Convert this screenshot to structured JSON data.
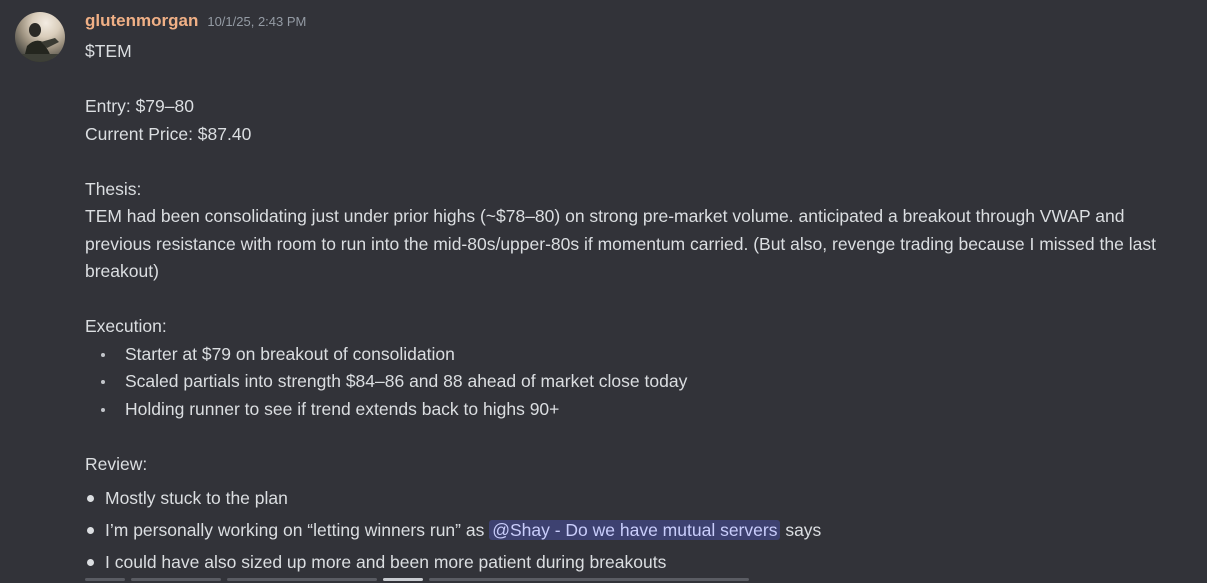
{
  "message": {
    "username": "glutenmorgan",
    "timestamp": "10/1/25, 2:43 PM",
    "avatar_icon": "user-avatar-photo",
    "username_color": "#f0b086",
    "ticker": "$TEM",
    "entry": "Entry: $79–80",
    "current_price": "Current Price: $87.40",
    "thesis_heading": "Thesis:",
    "thesis_text": "TEM had been consolidating just under prior highs (~$78–80) on strong pre-market volume. anticipated a breakout through VWAP and previous resistance with room to run into the mid-80s/upper-80s if momentum carried. (But also, revenge trading because I missed the last breakout)",
    "execution_heading": "Execution:",
    "execution_items": [
      "Starter at $79 on breakout of consolidation",
      "Scaled partials into strength $84–86 and 88 ahead of market close today",
      "Holding runner to see if trend extends back to highs 90+"
    ],
    "review_heading": "Review:",
    "review_items": [
      {
        "text": "Mostly stuck to the plan"
      },
      {
        "before": "I’m personally working on “letting winners run” as ",
        "mention": "@Shay - Do we have mutual servers",
        "after": " says"
      },
      {
        "text": "I could have also sized up more and been more patient during breakouts"
      }
    ],
    "mention_color": "#c9cdfb"
  }
}
